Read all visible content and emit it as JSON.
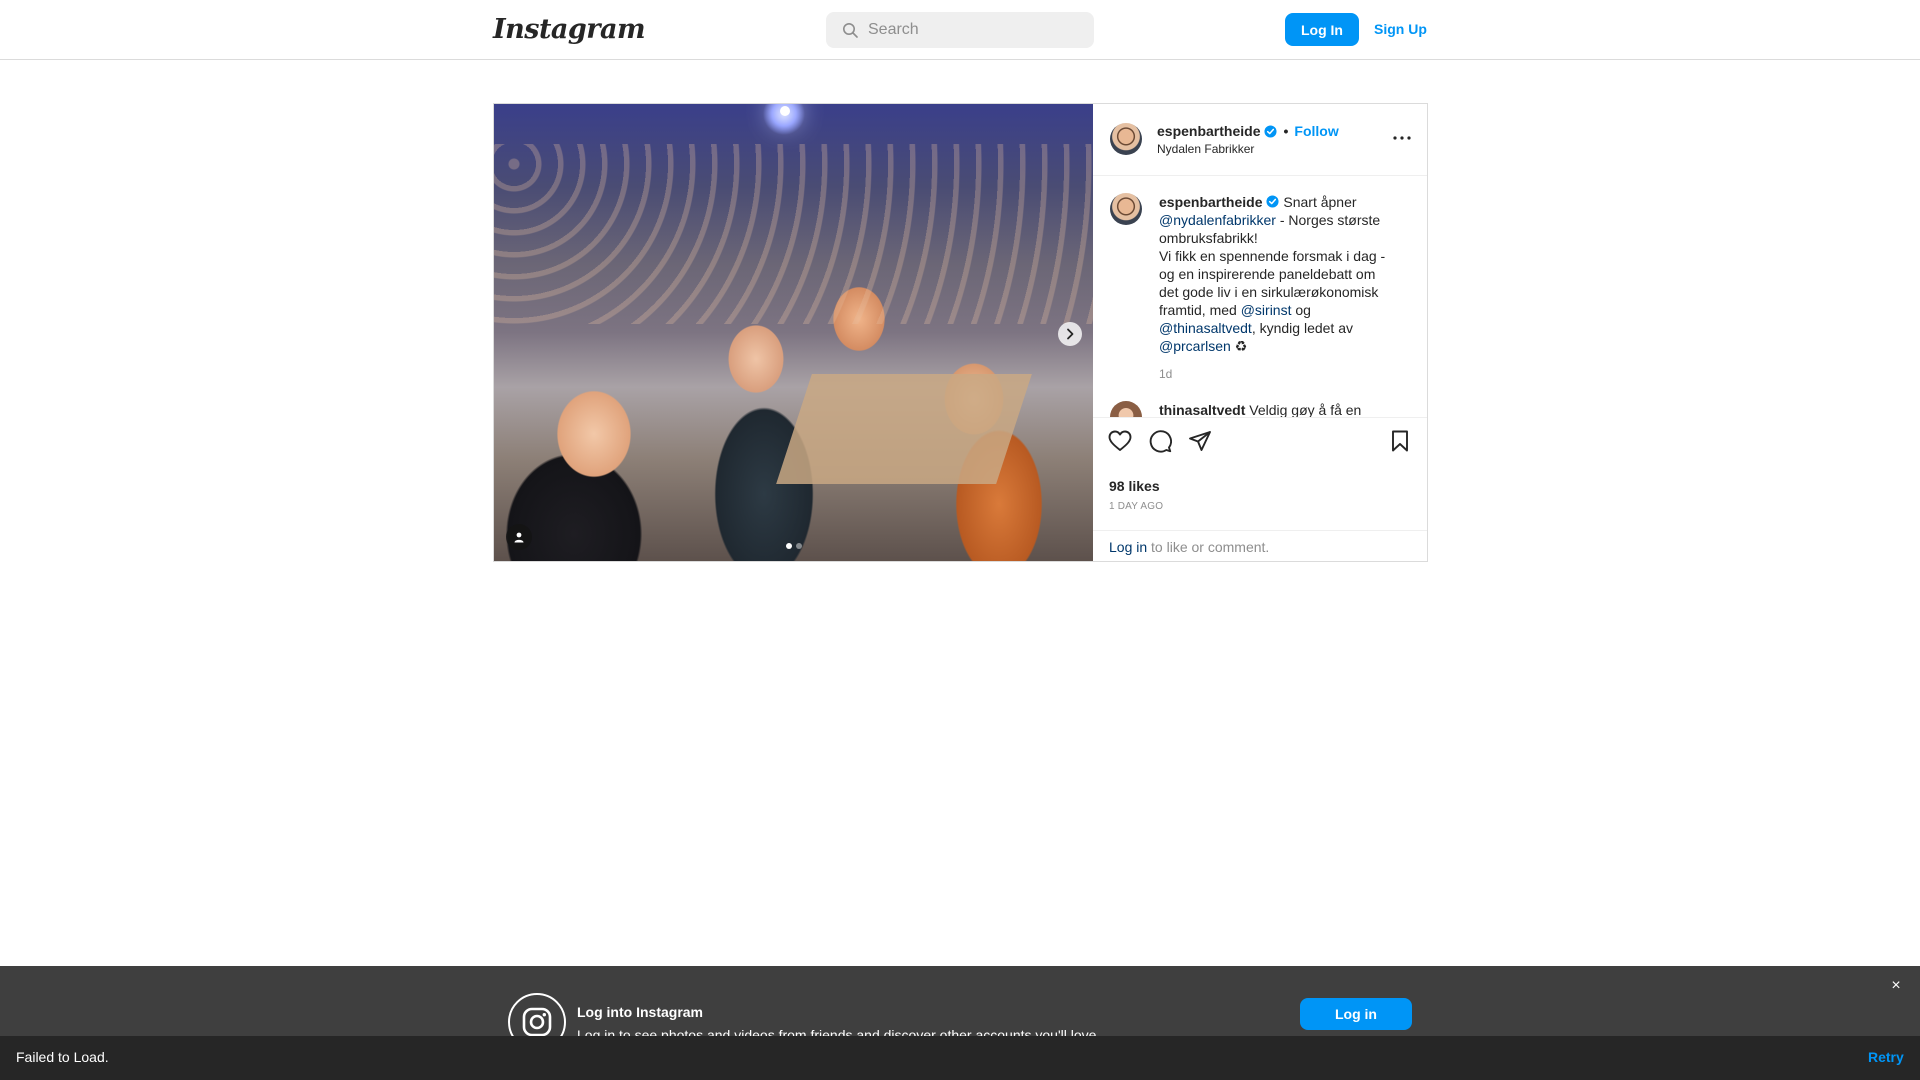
{
  "nav": {
    "logo_text": "Instagram",
    "search_placeholder": "Search",
    "login_label": "Log In",
    "signup_label": "Sign Up"
  },
  "post": {
    "username": "espenbartheide",
    "separator": "•",
    "follow_label": "Follow",
    "location": "Nydalen Fabrikker",
    "carousel": {
      "total_slides": 2,
      "active_slide": 1
    },
    "caption": {
      "username": "espenbartheide",
      "t1": "Snart åpner",
      "m1": "@nydalenfabrikker",
      "t2": "- Norges største ombruksfabrikk!",
      "t3": "Vi fikk en spennende forsmak i dag - og en inspirerende paneldebatt om det gode liv i en sirkulærøkonomisk framtid, med",
      "m2": "@sirinst",
      "t4": "og",
      "m3": "@thinasaltvedt",
      "t5": ", kyndig ledet av",
      "m4": "@prcarlsen",
      "t6": "♻",
      "time": "1d"
    },
    "comment": {
      "username": "thinasaltvedt",
      "text": "Veldig gøy å få en snik-"
    },
    "likes": "98 likes",
    "posted_ago": "1 DAY AGO",
    "login_link": "Log in",
    "login_suffix": "to like or comment."
  },
  "banner": {
    "title": "Log into Instagram",
    "subtitle": "Log in to see photos and videos from friends and discover other accounts you'll love.",
    "login_label": "Log in",
    "close_glyph": "×"
  },
  "toast": {
    "message": "Failed to Load.",
    "retry_label": "Retry"
  },
  "colors": {
    "accent": "#0095f6",
    "mention": "#00376b",
    "banner_bg": "#3f3f3f",
    "toast_bg": "#262626"
  }
}
